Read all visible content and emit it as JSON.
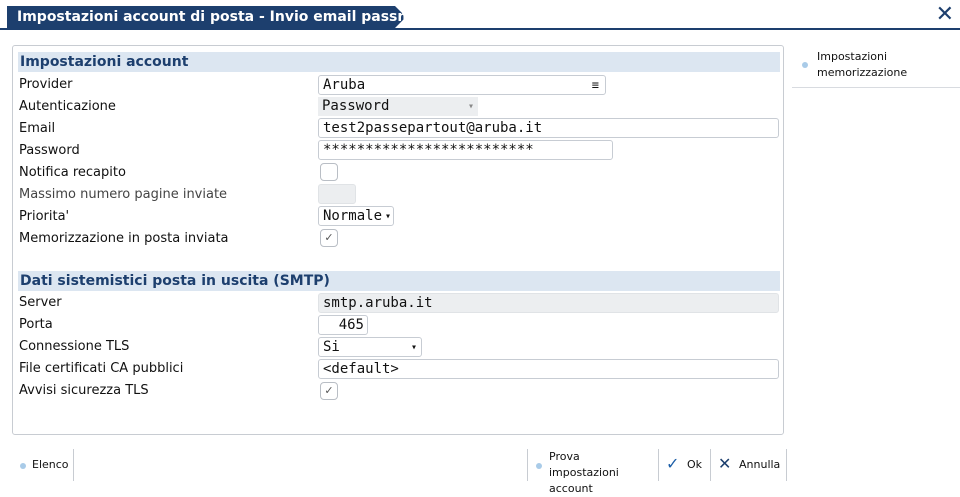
{
  "window": {
    "title": "Impostazioni account di posta - Invio email passmobile",
    "close_glyph": "✕"
  },
  "account_section": {
    "title": "Impostazioni account",
    "fields": {
      "provider": {
        "label": "Provider",
        "value": "Aruba",
        "icon": "list-icon",
        "glyph": "≡"
      },
      "autenticazione": {
        "label": "Autenticazione",
        "value": "Password",
        "caret": "▾"
      },
      "email": {
        "label": "Email",
        "value": "test2passepartout@aruba.it"
      },
      "password": {
        "label": "Password",
        "value": "*************************"
      },
      "notifica": {
        "label": "Notifica recapito",
        "checked": false
      },
      "massimo": {
        "label": "Massimo numero pagine inviate",
        "value": ""
      },
      "priorita": {
        "label": "Priorita'",
        "value": "Normale",
        "caret": "▾"
      },
      "memorizzazione": {
        "label": "Memorizzazione in posta inviata",
        "checked": true,
        "check_glyph": "✓"
      }
    }
  },
  "smtp_section": {
    "title": "Dati sistemistici posta in uscita (SMTP)",
    "fields": {
      "server": {
        "label": "Server",
        "value": "smtp.aruba.it"
      },
      "porta": {
        "label": "Porta",
        "value": "465"
      },
      "tls": {
        "label": "Connessione TLS",
        "value": "Si",
        "caret": "▾"
      },
      "certificati": {
        "label": "File certificati CA pubblici",
        "value": "<default>"
      },
      "avvisi": {
        "label": "Avvisi sicurezza TLS",
        "checked": true,
        "check_glyph": "✓"
      }
    }
  },
  "right_panel": {
    "item_label": "Impostazioni memorizzazione"
  },
  "footer": {
    "elenco_label": "Elenco",
    "prova_label": "Prova impostazioni account",
    "ok_label": "Ok",
    "ok_glyph": "✓",
    "annulla_label": "Annulla",
    "annulla_glyph": "✕"
  },
  "colors": {
    "accent": "#1d3f6e",
    "section_bg": "#dce6f1",
    "dot": "#a9cbe8"
  }
}
